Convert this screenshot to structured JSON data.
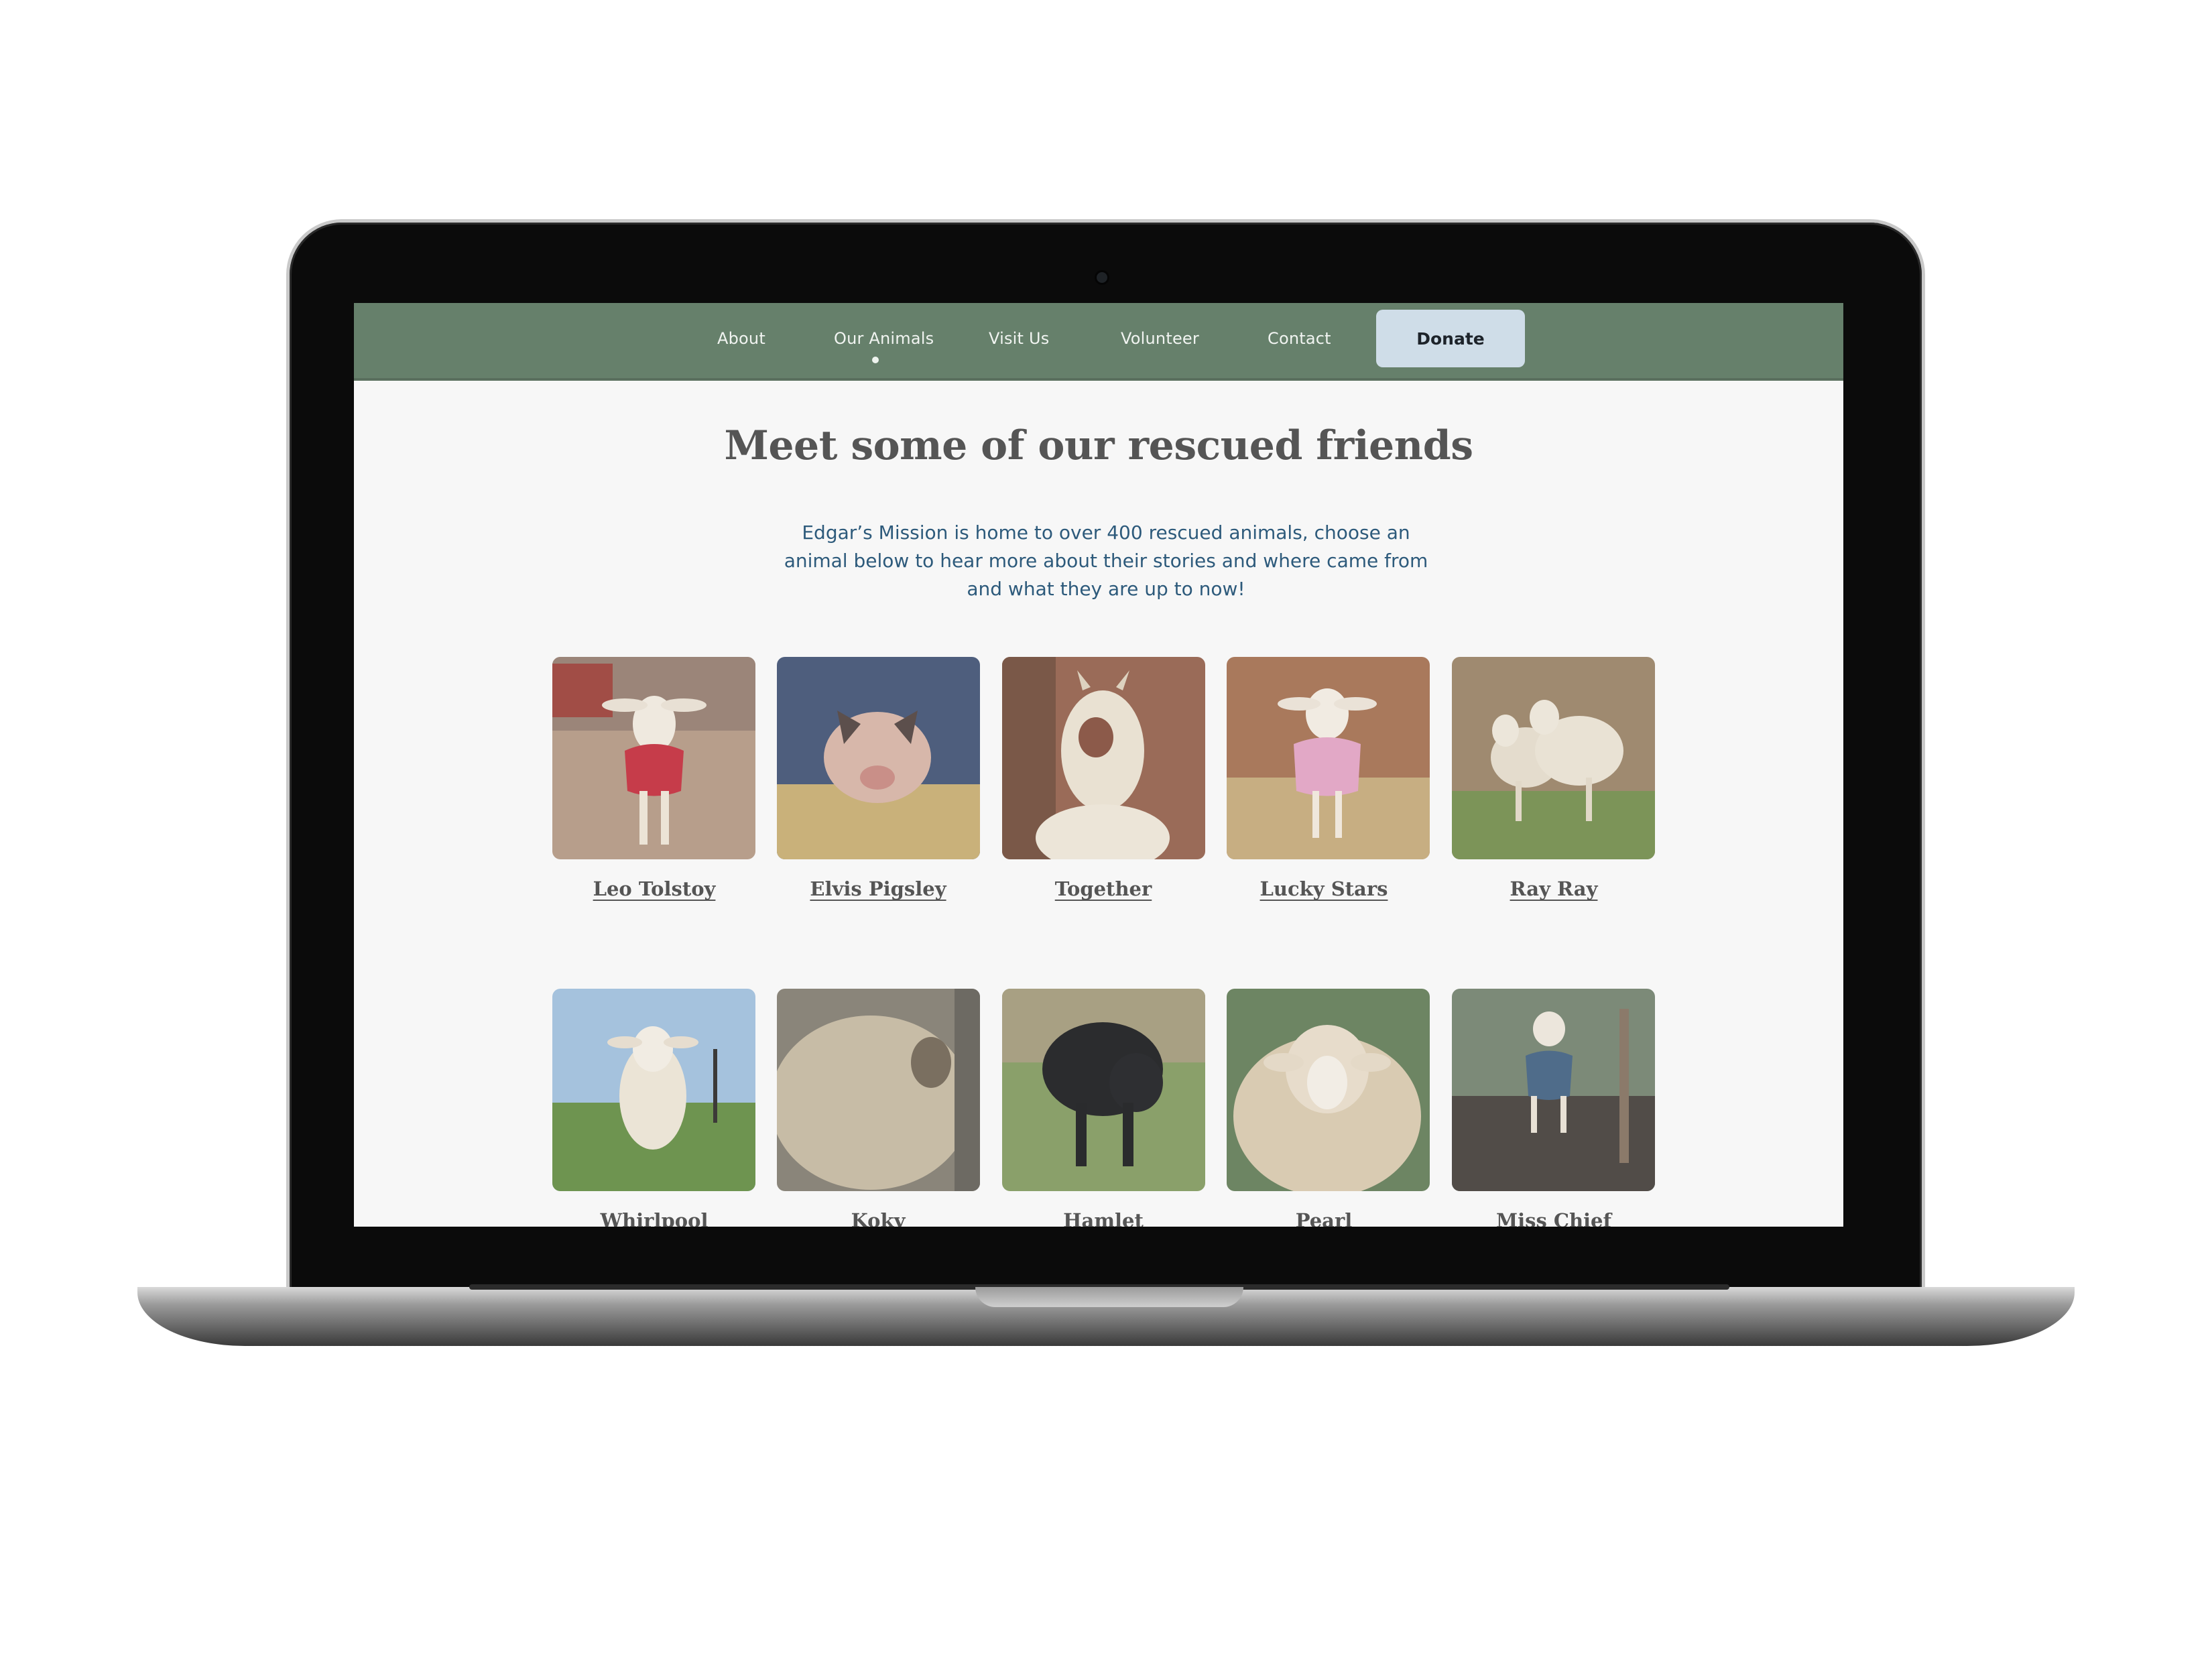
{
  "nav": {
    "items": [
      {
        "label": "About"
      },
      {
        "label": "Our Animals",
        "active": true
      },
      {
        "label": "Visit Us"
      },
      {
        "label": "Volunteer"
      },
      {
        "label": "Contact"
      }
    ],
    "donate_label": "Donate",
    "bar_color": "#66806b",
    "donate_color": "#cfdde8"
  },
  "main": {
    "heading": "Meet some of our rescued friends",
    "intro": "Edgar’s Mission is home to over 400 rescued animals, choose an animal below to hear more about their stories and where came from and what they are up to now!",
    "intro_color": "#2d5a7b"
  },
  "animals": [
    {
      "name": "Leo Tolstoy",
      "species": "lamb"
    },
    {
      "name": "Elvis Pigsley",
      "species": "piglet"
    },
    {
      "name": "Together",
      "species": "goat"
    },
    {
      "name": "Lucky Stars",
      "species": "lamb"
    },
    {
      "name": "Ray Ray",
      "species": "lambs"
    },
    {
      "name": "Whirlpool",
      "species": "sheep"
    },
    {
      "name": "Koky",
      "species": "sheep"
    },
    {
      "name": "Hamlet",
      "species": "pig"
    },
    {
      "name": "Pearl",
      "species": "sheep"
    },
    {
      "name": "Miss Chief",
      "species": "lamb"
    }
  ]
}
